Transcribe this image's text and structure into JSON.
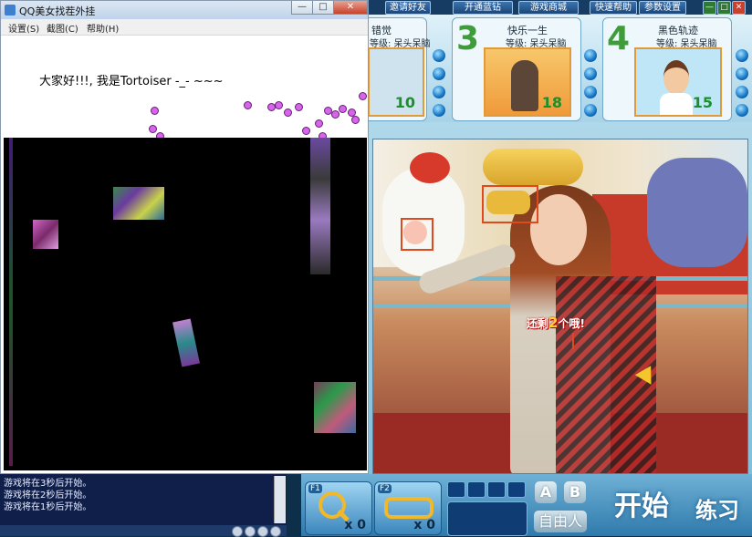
{
  "tool_window": {
    "title": "QQ美女找茬外挂",
    "controls": {
      "minimize": "—",
      "maximize": "□",
      "close": "✕"
    },
    "menu": [
      "设置(S)",
      "截图(C)",
      "帮助(H)"
    ],
    "greeting": "大家好!!!, 我是Tortoiser -_- ~~~"
  },
  "log": {
    "lines": [
      "游戏将在3秒后开始。",
      "游戏将在2秒后开始。",
      "游戏将在1秒后开始。"
    ]
  },
  "game": {
    "top_buttons": [
      "邀请好友",
      "开通蓝钻",
      "游戏商城",
      "快速帮助",
      "参数设置"
    ],
    "window_controls": {
      "minimize": "—",
      "maximize": "□",
      "close": "✕"
    },
    "players": [
      {
        "number": "",
        "name": "错觉",
        "level": "等级: 呆头呆脑",
        "score": "10"
      },
      {
        "number": "3",
        "name": "快乐一生",
        "level": "等级: 呆头呆脑",
        "score": "18"
      },
      {
        "number": "4",
        "name": "黑色轨迹",
        "level": "等级: 呆头呆脑",
        "score": "15"
      }
    ],
    "remaining": {
      "prefix": "还剩",
      "count": "2",
      "suffix": "个哦!"
    },
    "tools": [
      {
        "key": "F1",
        "icon": "magnifier-icon",
        "count": "x 0"
      },
      {
        "key": "F2",
        "icon": "goggles-icon",
        "count": "x 0"
      }
    ],
    "buttons": {
      "a": "A",
      "b": "B",
      "free": "自由人",
      "start": "开始",
      "practice": "练习"
    }
  }
}
